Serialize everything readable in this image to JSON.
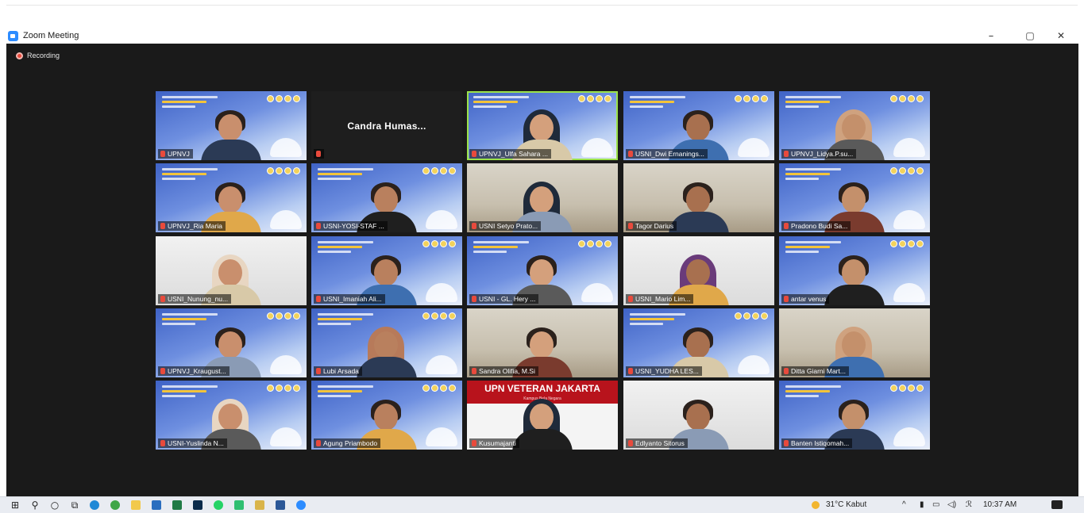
{
  "window": {
    "title": "Zoom Meeting",
    "minimize": "–",
    "restore": "▢",
    "close": "✕"
  },
  "recording": {
    "label": "Recording"
  },
  "participants": [
    {
      "name": "UPNVJ",
      "style": "banner"
    },
    {
      "name": "Candra  Humas...",
      "style": "black"
    },
    {
      "name": "UPNVJ_Ulfa Sahara ...",
      "style": "banner",
      "active": true
    },
    {
      "name": "USNI_Dwi Ernanings...",
      "style": "banner"
    },
    {
      "name": "UPNVJ_Lidya.P.su...",
      "style": "banner"
    },
    {
      "name": "UPNVJ_Ria Maria",
      "style": "banner"
    },
    {
      "name": "USNI-YOSI-STAF ...",
      "style": "banner"
    },
    {
      "name": "USNI Setyo Prato...",
      "style": "room"
    },
    {
      "name": "Tagor Darius",
      "style": "room"
    },
    {
      "name": "Pradono Budi Sa...",
      "style": "banner"
    },
    {
      "name": "USNI_Nunung_nu...",
      "style": "white"
    },
    {
      "name": "USNI_Imaniah Ali...",
      "style": "banner"
    },
    {
      "name": "USNI - GL. Hery ...",
      "style": "banner"
    },
    {
      "name": "USNI_Mario Lim...",
      "style": "white"
    },
    {
      "name": "antar venus",
      "style": "banner"
    },
    {
      "name": "UPNVJ_Kraugust...",
      "style": "banner"
    },
    {
      "name": "Lubi Arsada",
      "style": "banner"
    },
    {
      "name": "Sandra Olifia, M.Si",
      "style": "room"
    },
    {
      "name": "USNI_YUDHA LES...",
      "style": "banner"
    },
    {
      "name": "Ditta Giarni Mart...",
      "style": "room"
    },
    {
      "name": "USNI-Yuslinda N...",
      "style": "banner"
    },
    {
      "name": "Agung Priambodo",
      "style": "banner"
    },
    {
      "name": "Kusumajanti",
      "style": "red"
    },
    {
      "name": "Edlyanto Sitorus",
      "style": "white"
    },
    {
      "name": "Banten Istiqomah...",
      "style": "banner"
    }
  ],
  "upn_banner": {
    "title": "UPN VETERAN JAKARTA",
    "subtitle": "Kampus Bela Negara"
  },
  "taskbar": {
    "weather": "31°C  Kabut",
    "time": "10:37 AM",
    "apps": [
      "windows-start",
      "search",
      "cortana",
      "task-view",
      "edge",
      "chrome",
      "file-explorer",
      "store",
      "excel",
      "photoshop",
      "whatsapp",
      "app-green",
      "app-yellow",
      "word",
      "zoom"
    ]
  }
}
